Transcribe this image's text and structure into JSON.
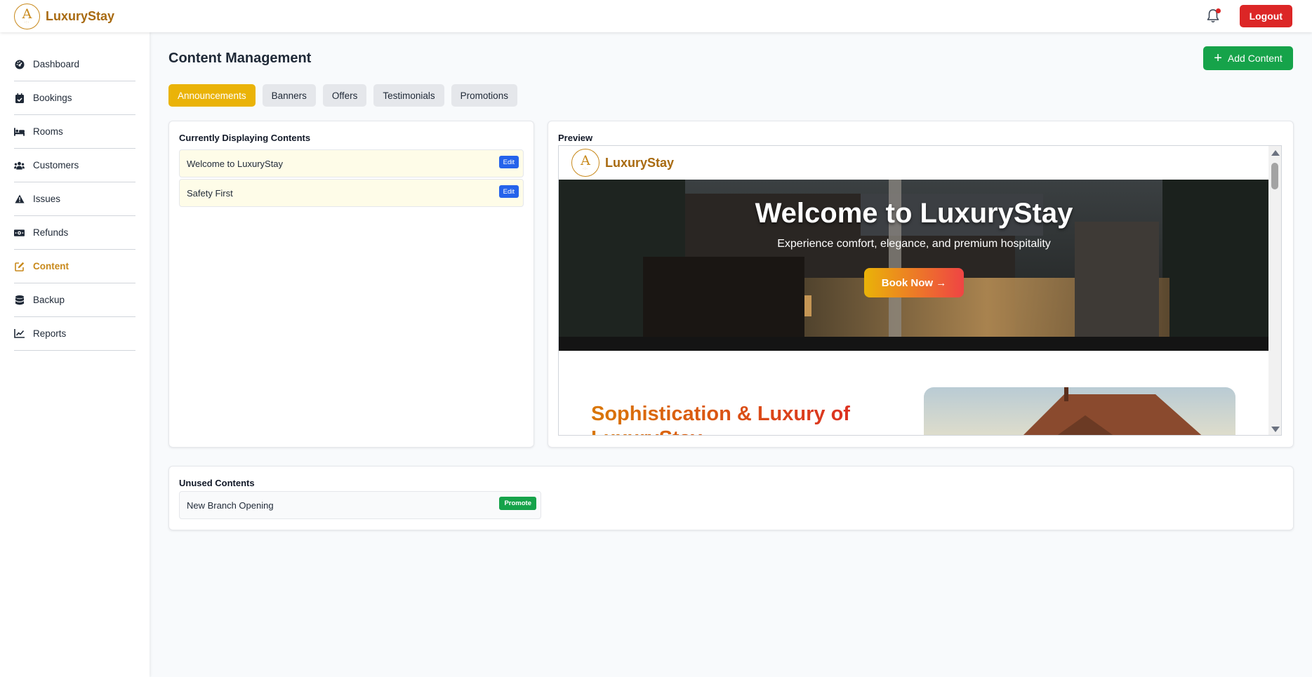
{
  "app": {
    "brand": "LuxuryStay",
    "logo_letter": "A"
  },
  "header": {
    "logout_label": "Logout",
    "notification_dot": true
  },
  "sidebar": {
    "items": [
      {
        "label": "Dashboard",
        "icon": "dashboard-gauge-icon",
        "active": false
      },
      {
        "label": "Bookings",
        "icon": "calendar-check-icon",
        "active": false
      },
      {
        "label": "Rooms",
        "icon": "bed-icon",
        "active": false
      },
      {
        "label": "Customers",
        "icon": "users-icon",
        "active": false
      },
      {
        "label": "Issues",
        "icon": "warning-triangle-icon",
        "active": false
      },
      {
        "label": "Refunds",
        "icon": "money-bill-icon",
        "active": false
      },
      {
        "label": "Content",
        "icon": "edit-icon",
        "active": true
      },
      {
        "label": "Backup",
        "icon": "database-icon",
        "active": false
      },
      {
        "label": "Reports",
        "icon": "line-chart-icon",
        "active": false
      }
    ]
  },
  "main": {
    "title": "Content Management",
    "add_button_label": "Add Content",
    "tabs": [
      {
        "label": "Announcements",
        "active": true
      },
      {
        "label": "Banners",
        "active": false
      },
      {
        "label": "Offers",
        "active": false
      },
      {
        "label": "Testimonials",
        "active": false
      },
      {
        "label": "Promotions",
        "active": false
      }
    ],
    "displaying": {
      "title": "Currently Displaying Contents",
      "items": [
        {
          "title": "Welcome to LuxuryStay",
          "action": "Edit"
        },
        {
          "title": "Safety First",
          "action": "Edit"
        }
      ]
    },
    "preview": {
      "title": "Preview",
      "brand": "LuxuryStay",
      "hero_title": "Welcome to LuxuryStay",
      "hero_subtitle": "Experience comfort, elegance, and premium hospitality",
      "hero_button": "Book Now →",
      "section_title": "Sophistication & Luxury of LuxuryStay"
    },
    "unused": {
      "title": "Unused Contents",
      "items": [
        {
          "title": "New Branch Opening",
          "action": "Promote"
        }
      ]
    }
  },
  "colors": {
    "brand_gold": "#c8891b",
    "active_tab": "#eab308",
    "logout_red": "#dc2626",
    "add_green": "#16a34a",
    "edit_blue": "#2563eb"
  }
}
